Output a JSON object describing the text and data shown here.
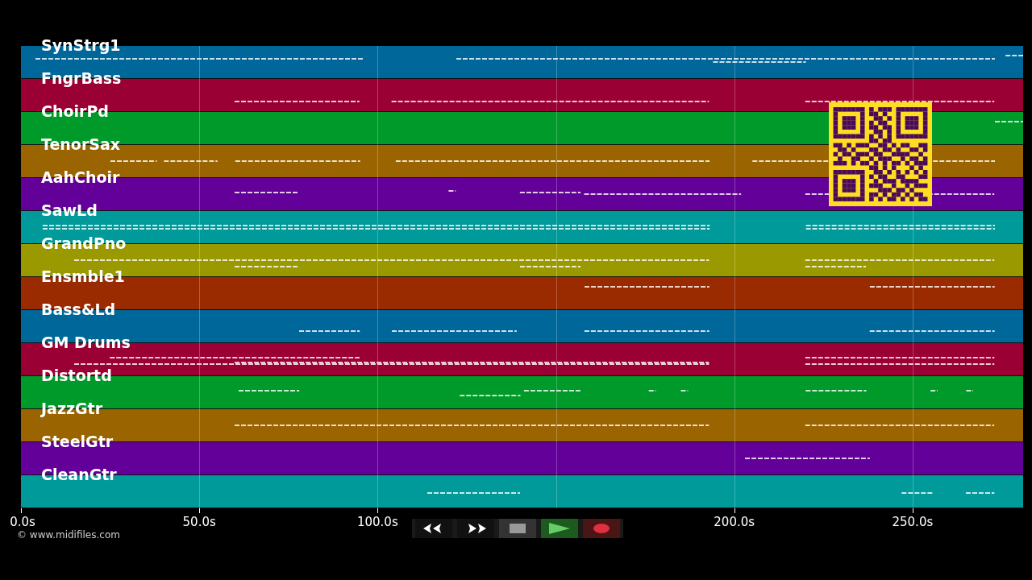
{
  "tracks": [
    {
      "name": "SynStrg1",
      "color": "#00679a"
    },
    {
      "name": "FngrBass",
      "color": "#9a0033"
    },
    {
      "name": "ChoirPd",
      "color": "#009a2a"
    },
    {
      "name": "TenorSax",
      "color": "#9a6400"
    },
    {
      "name": "AahChoir",
      "color": "#64009a"
    },
    {
      "name": "SawLd",
      "color": "#009a9a"
    },
    {
      "name": "GrandPno",
      "color": "#9a9a00"
    },
    {
      "name": "Ensmble1",
      "color": "#9a2a00"
    },
    {
      "name": "Bass&Ld",
      "color": "#00679a"
    },
    {
      "name": "GM Drums",
      "color": "#9a0033"
    },
    {
      "name": "Distortd",
      "color": "#009a2a"
    },
    {
      "name": "JazzGtr",
      "color": "#9a6400"
    },
    {
      "name": "SteelGtr",
      "color": "#64009a"
    },
    {
      "name": "CleanGtr",
      "color": "#009a9a"
    }
  ],
  "time_axis": {
    "ticks": [
      "0.0s",
      "50.0s",
      "100.0s",
      "200.0s",
      "250.0s"
    ]
  },
  "credit": "© www.midifiles.com",
  "transport": [
    {
      "kind": "rewind"
    },
    {
      "kind": "fast-forward"
    },
    {
      "kind": "stop"
    },
    {
      "kind": "play"
    },
    {
      "kind": "record"
    }
  ]
}
